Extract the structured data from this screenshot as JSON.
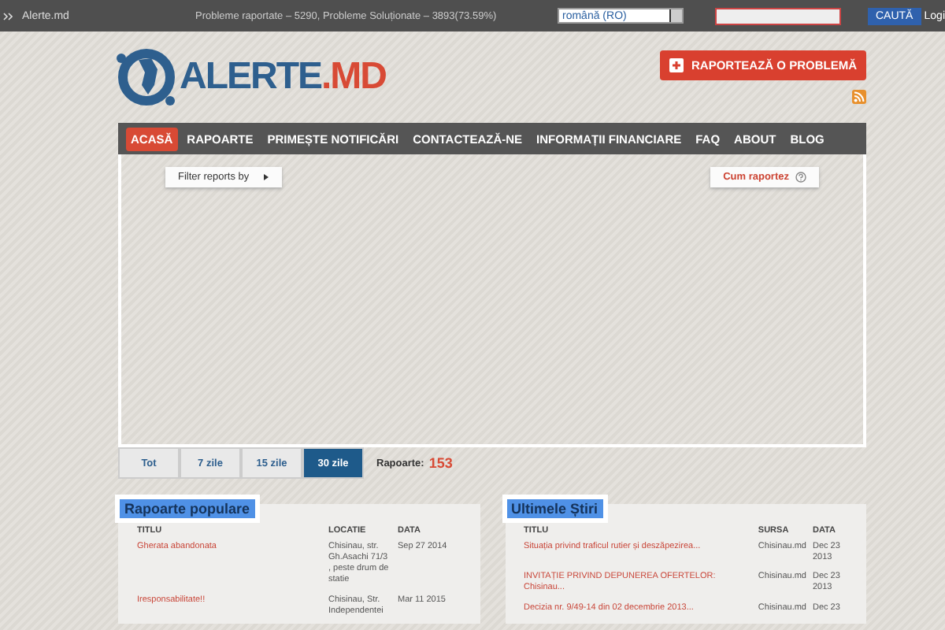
{
  "top_bar": {
    "site": "Alerte.md",
    "stats": "Probleme raportate – 5290, Probleme Soluționate – 3893(73.59%)",
    "language": "română (RO)",
    "search_button": "CAUTĂ",
    "login": "Logi"
  },
  "header": {
    "logo_text": "ALERTE",
    "logo_suffix": ".MD",
    "report_button": "RAPORTEAZĂ O PROBLEMĂ"
  },
  "nav": [
    {
      "label": "ACASĂ",
      "selected": true
    },
    {
      "label": "RAPOARTE",
      "selected": false
    },
    {
      "label": "PRIMEȘTE NOTIFICĂRI",
      "selected": false
    },
    {
      "label": "CONTACTEAZĂ-NE",
      "selected": false
    },
    {
      "label": "INFORMAȚII FINANCIARE",
      "selected": false
    },
    {
      "label": "FAQ",
      "selected": false
    },
    {
      "label": "ABOUT",
      "selected": false
    },
    {
      "label": "BLOG",
      "selected": false
    }
  ],
  "map": {
    "filter_button": "Filter reports by",
    "how_button": "Cum raportez"
  },
  "period_tabs": [
    {
      "label": "Tot",
      "selected": false
    },
    {
      "label": "7 zile",
      "selected": false
    },
    {
      "label": "15 zile",
      "selected": false
    },
    {
      "label": "30 zile",
      "selected": true
    }
  ],
  "reports_count": {
    "label": "Rapoarte:",
    "value": "153"
  },
  "popular": {
    "title": "Rapoarte populare",
    "columns": [
      "TITLU",
      "LOCATIE",
      "DATA"
    ],
    "rows": [
      {
        "title": "Gherata abandonata",
        "location": "Chisinau, str. Gh.Asachi 71/3 , peste drum de statie",
        "date": "Sep 27 2014"
      },
      {
        "title": "Iresponsabilitate!!",
        "location": "Chisinau, Str. Independentei",
        "date": "Mar 11 2015"
      }
    ]
  },
  "news": {
    "title": "Ultimele Știri",
    "columns": [
      "TITLU",
      "SURSA",
      "DATA"
    ],
    "rows": [
      {
        "title": "Situația privind traficul rutier și deszăpezirea...",
        "source": "Chisinau.md",
        "date": "Dec 23 2013"
      },
      {
        "title": "INVITAȚIE PRIVIND DEPUNEREA OFERTELOR: Chisinau...",
        "source": "Chisinau.md",
        "date": "Dec 23 2013"
      },
      {
        "title": "Decizia nr. 9/49-14 din 02 decembrie 2013...",
        "source": "Chisinau.md",
        "date": "Dec 23"
      }
    ]
  }
}
